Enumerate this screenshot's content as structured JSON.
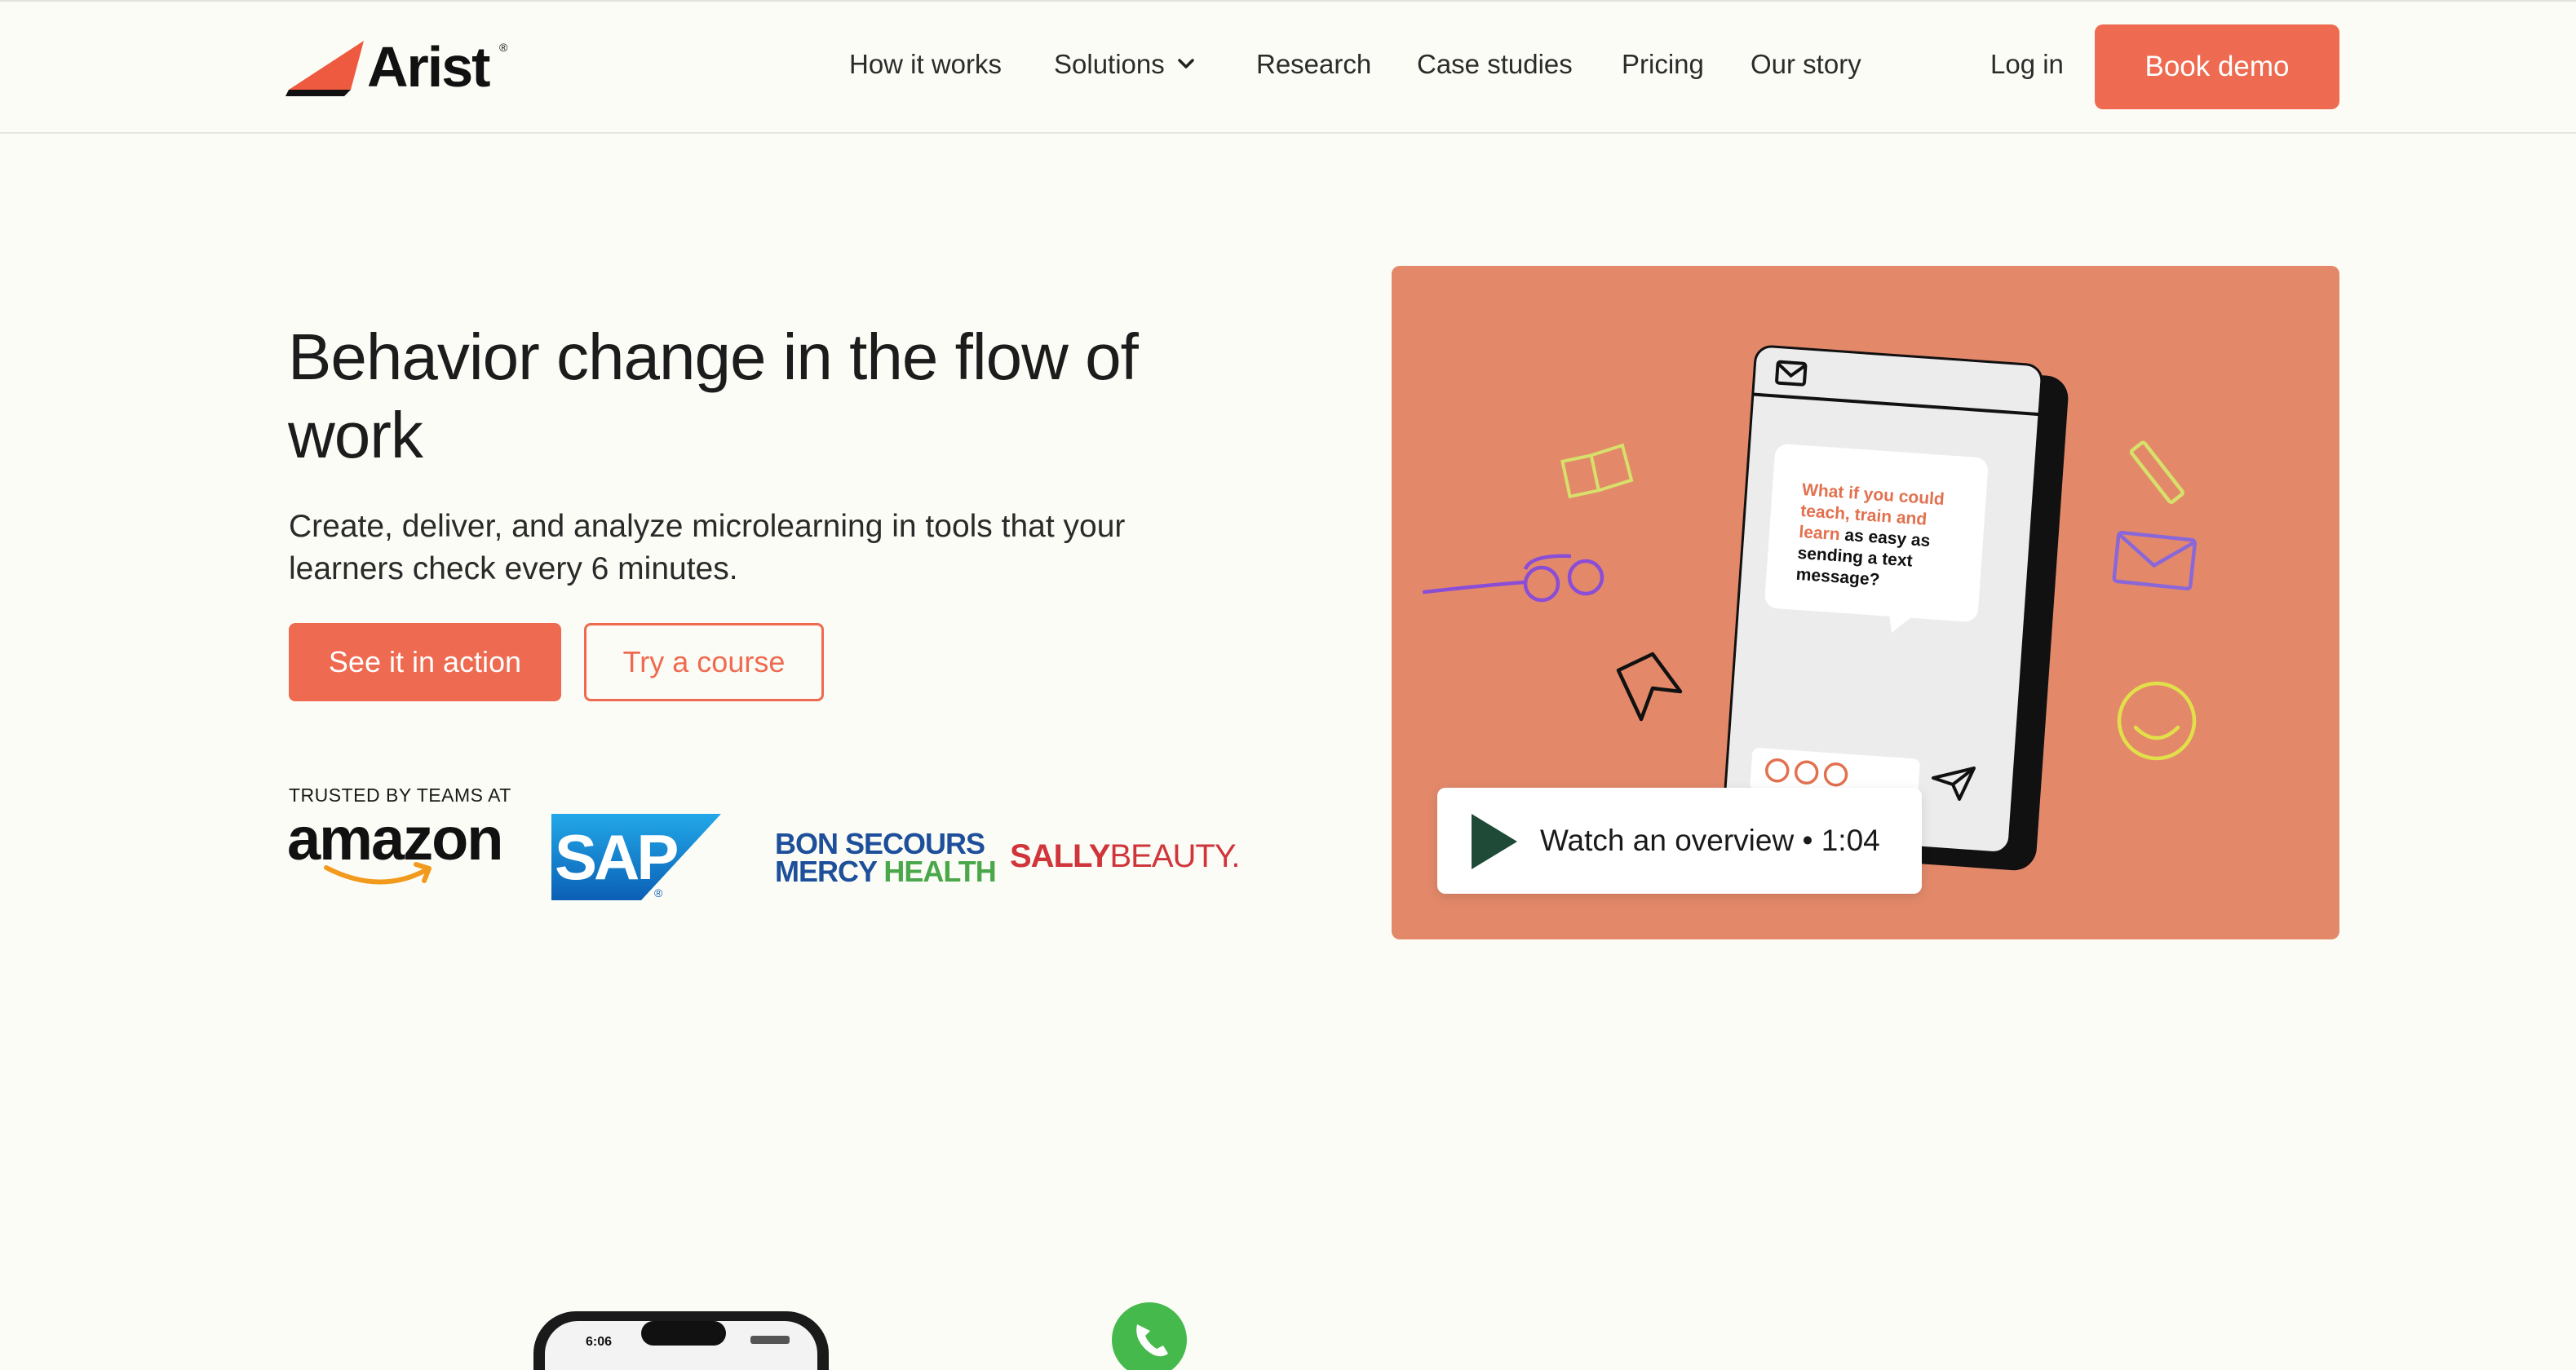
{
  "brand": {
    "logo_text": "Arist",
    "logo_mark": "®",
    "accent": "#ee6a50"
  },
  "nav": {
    "items": [
      "How it works",
      "Solutions",
      "Research",
      "Case studies",
      "Pricing",
      "Our story"
    ],
    "login": "Log in",
    "cta": "Book demo"
  },
  "hero": {
    "title": "Behavior change in the flow of work",
    "subtitle": "Create, deliver, and analyze microlearning in tools that your learners check every 6 minutes.",
    "primary_cta": "See it in action",
    "secondary_cta": "Try a course"
  },
  "trusted": {
    "label": "TRUSTED BY TEAMS AT",
    "logos": [
      "amazon",
      "SAP",
      "BON SECOURS",
      "MERCY",
      "HEALTH",
      "SALLY",
      "BEAUTY."
    ]
  },
  "video": {
    "background": "#e3896a",
    "chat_highlight": "What if you could teach, train and learn",
    "chat_rest": "as easy as sending a text message?",
    "watch_label": "Watch an overview",
    "duration": "1:04"
  },
  "bottom": {
    "phone_time": "6:06"
  },
  "icons": [
    "chevron-down-icon",
    "play-icon",
    "mail-icon",
    "book-icon",
    "glasses-icon",
    "cursor-icon",
    "pencil-icon",
    "envelope-icon",
    "smiley-icon",
    "send-icon",
    "whatsapp-icon"
  ]
}
